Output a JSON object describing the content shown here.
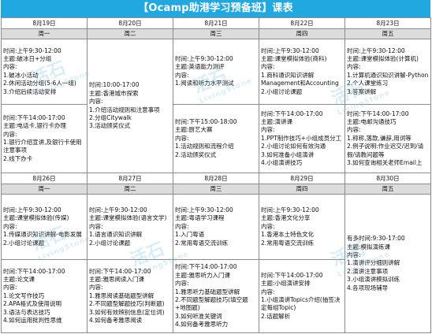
{
  "title": "【Ocamp助港学习预备班】课表",
  "watermark": {
    "brand_cn": "活石",
    "brand_en": "LivingStone",
    "color": "#7ebee1"
  },
  "colors": {
    "title_bg": "#22a8e0",
    "weekday_bg": "#dcdcdc",
    "border": "#8c8c8c"
  },
  "week1": {
    "dates": [
      "8月19日",
      "8月20日",
      "8月21日",
      "8月22日",
      "8月23日"
    ],
    "weekdays": [
      "周一",
      "周二",
      "周三",
      "周四",
      "周五"
    ],
    "mon": {
      "am": [
        "时间:上午9:30-12:00",
        "主题:破冰日+分组",
        "内容:",
        "1.破冰小活动",
        "2.休闲活动分组(5-6人一组)",
        "3.介绍后续活动安排"
      ],
      "pm": [
        "时间:下午14:00-17:00",
        "主题:电话卡,银行卡办理",
        "内容:",
        "1.银行介绍宣讲,及银行卡使用注意事项",
        "2.线下办卡"
      ]
    },
    "tue": [
      "时间:10:00-17:00",
      "主题:香港城市探索",
      "内容:",
      "1.介绍活动规则和注意事项",
      "2.分组Citywalk",
      "3.活动颁奖仪式"
    ],
    "wed": {
      "am": [
        "时间:上午9:30-12:00",
        "主题:英语能力测评",
        "内容:",
        "1.阅读和听力水平测试"
      ],
      "pm": [
        "时间:下午15:00-18:00",
        "主题:厨艺大赛",
        "内容:",
        "1.活动规则和流程介绍",
        "2.活动颁奖仪式"
      ]
    },
    "thu": {
      "am": [
        "时间:上午9:30-12:00",
        "主题:课堂模拟体验(商科)",
        "内容:",
        "1.商科通识知识讲解Management和Accounting",
        "2.小组讨论课题"
      ],
      "pm": [
        "时间:下午14:00-17:00",
        "主题:演讲课",
        "内容:",
        "1.PPT制作技巧+小组成员分工",
        "2.小组讨论如何有效沟通",
        "3.如何准备小组演讲",
        "4.小组演讲技巧"
      ]
    },
    "fri": {
      "am": [
        "时间:上午9:30-12:00",
        "主题:课堂模拟体验(计算机)",
        "内容:",
        "1.计算机通识知识讲解-Python",
        "2.个人课堂练习",
        "3.答案讲解"
      ],
      "pm": [
        "时间:下午14:00-17:00",
        "主题:电邮沟通技巧",
        "内容:",
        "1.称称,落款,谦辞,用词等",
        "2.例子说明:作业迟交/迟到/请假/请教问题等",
        "3.如何查询相关老师Email上"
      ]
    }
  },
  "week2": {
    "dates": [
      "8月26日",
      "8月27日",
      "8月28日",
      "8月29日",
      "8月30日"
    ],
    "weekdays": [
      "周一",
      "周二",
      "周三",
      "周四",
      "周五"
    ],
    "mon": {
      "am": [
        "时间:上午9:30-12:00",
        "主题:课堂模拟体验(传媒)",
        "内容:",
        "1.传媒通识知识讲解-电影发展",
        "2.小组讨论课题"
      ],
      "pm": [
        "时间:下午14:00-17:00",
        "主题:论文课",
        "内容:",
        "1.论文写作技巧",
        "2.APA格式及使用说明",
        "3.语法与表达技巧",
        "4.如何运用批判性思维"
      ]
    },
    "tue": {
      "am": [
        "时间:上午9:30-12:00",
        "主题:课堂模拟体验(语言文学)",
        "内容:",
        "1.语言通识知识讲解",
        "2.小组讨论课题"
      ],
      "pm": [
        "时间:下午14:00-17:00",
        "主题:雅思阅读入门课",
        "内容:",
        "1.雅思阅读基础题型讲解",
        "2.不同题型解题技巧(判断题)",
        "3.如何有效辨别信息(定位词)",
        "4.如何备考雅思阅读"
      ]
    },
    "wed": {
      "am": [
        "时间:上午9:30-12:00",
        "主题:粤语学习课程",
        "内容:",
        "1.入门粤语",
        "2.常用粤语交流训练"
      ],
      "pm": [
        "时间:下午14:00-17:00",
        "主题:雅思听力入门课",
        "内容:",
        "1.雅思听力基础题型讲解",
        "2.不同题型解题技巧(填空题+地图题)",
        "3.如何听准关键词",
        "4.如何备考雅思听力"
      ]
    },
    "thu": {
      "am": [
        "时间:上午9:30-12:00",
        "主题:香港文化分享",
        "内容:",
        "1.香港本土特色文化",
        "2.常用粤语交流训练"
      ],
      "pm": [
        "时间:下午14:00-17:00",
        "主题:小组演讲安排",
        "内容:",
        "1.小组演讲Topics介绍(抽签决定每组Topic)",
        "2.话题解析"
      ]
    },
    "fri": [
      "有多时间:9:30-17:00",
      "主题:模拟演练课",
      "内容:",
      "1.演讲评分细则讲解",
      "2.演讲注意事项",
      "3.小组演讲模拟训练",
      "4.各项现场辅导"
    ]
  }
}
